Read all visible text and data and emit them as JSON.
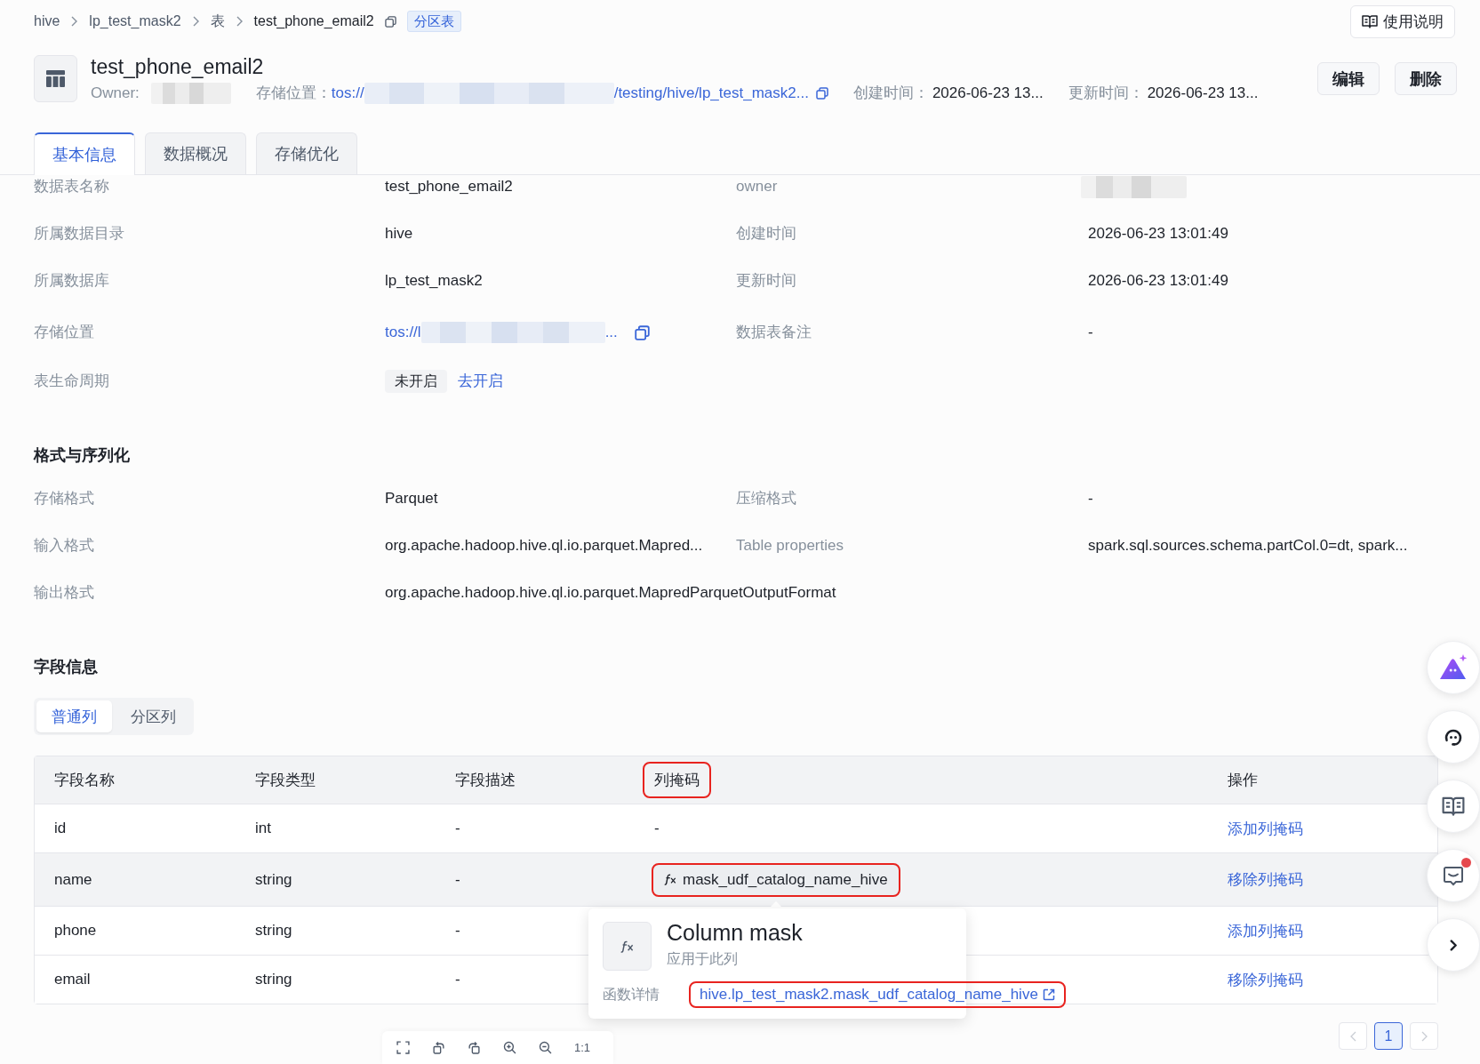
{
  "breadcrumb": {
    "items": [
      {
        "label": "hive",
        "current": false
      },
      {
        "label": "lp_test_mask2",
        "current": false
      },
      {
        "label": "表",
        "current": false
      },
      {
        "label": "test_phone_email2",
        "current": true
      }
    ],
    "tag": "分区表"
  },
  "help_button": "使用说明",
  "header": {
    "title": "test_phone_email2",
    "owner_label": "Owner:",
    "owner_redacted": true,
    "storage_label": "存储位置：",
    "storage_prefix": "tos://",
    "storage_redacted": true,
    "storage_suffix": "/testing/hive/lp_test_mask2...",
    "created_label": "创建时间：",
    "created_value": "2026-06-23 13...",
    "updated_label": "更新时间：",
    "updated_value": "2026-06-23 13..."
  },
  "actions": [
    "编辑",
    "删除"
  ],
  "tabs": [
    {
      "label": "基本信息",
      "selected": true
    },
    {
      "label": "数据概况",
      "selected": false
    },
    {
      "label": "存储优化",
      "selected": false
    }
  ],
  "basic_info": {
    "rows": [
      [
        {
          "kind": "text",
          "label": "数据表名称",
          "value": "test_phone_email2"
        },
        {
          "kind": "redacted",
          "label": "owner"
        }
      ],
      [
        {
          "kind": "text",
          "label": "所属数据目录",
          "value": "hive"
        },
        {
          "kind": "text",
          "label": "创建时间",
          "value": "2026-06-23 13:01:49"
        }
      ],
      [
        {
          "kind": "text",
          "label": "所属数据库",
          "value": "lp_test_mask2"
        },
        {
          "kind": "text",
          "label": "更新时间",
          "value": "2026-06-23 13:01:49"
        }
      ],
      [
        {
          "kind": "path",
          "label": "存储位置",
          "prefix": "tos://l",
          "redacted": true,
          "suffix": "..."
        },
        {
          "kind": "text",
          "label": "数据表备注",
          "value": "-"
        }
      ],
      [
        {
          "kind": "status",
          "label": "表生命周期",
          "tag": "未开启",
          "action": "去开启"
        }
      ]
    ]
  },
  "format": {
    "title": "格式与序列化",
    "rows": [
      [
        {
          "kind": "text",
          "label": "存储格式",
          "value": "Parquet"
        },
        {
          "kind": "text",
          "label": "压缩格式",
          "value": "-"
        }
      ],
      [
        {
          "kind": "text",
          "label": "输入格式",
          "value": "org.apache.hadoop.hive.ql.io.parquet.Mapred..."
        },
        {
          "kind": "text",
          "label": "Table properties",
          "value": "spark.sql.sources.schema.partCol.0=dt, spark..."
        }
      ],
      [
        {
          "kind": "text",
          "label": "输出格式",
          "value": "org.apache.hadoop.hive.ql.io.parquet.MapredParquetOutputFormat"
        }
      ]
    ]
  },
  "fields": {
    "title": "字段信息",
    "segments": [
      {
        "label": "普通列",
        "selected": true
      },
      {
        "label": "分区列",
        "selected": false
      }
    ],
    "columns": [
      {
        "label": "字段名称",
        "highlighted": false
      },
      {
        "label": "字段类型",
        "highlighted": false
      },
      {
        "label": "字段描述",
        "highlighted": false
      },
      {
        "label": "列掩码",
        "highlighted": true
      },
      {
        "label": "操作",
        "highlighted": false
      }
    ],
    "rows": [
      {
        "name": "id",
        "type": "int",
        "description": "-",
        "mask": {
          "kind": "none",
          "text": "-"
        },
        "action": "添加列掩码",
        "hovered": false
      },
      {
        "name": "name",
        "type": "string",
        "description": "-",
        "mask": {
          "kind": "function",
          "text": "mask_udf_catalog_name_hive",
          "highlighted": true
        },
        "action": "移除列掩码",
        "hovered": true
      },
      {
        "name": "phone",
        "type": "string",
        "description": "-",
        "action": "添加列掩码",
        "hovered": false
      },
      {
        "name": "email",
        "type": "string",
        "description": "-",
        "action": "移除列掩码",
        "hovered": false
      }
    ],
    "popover": {
      "title": "Column mask",
      "subtitle": "应用于此列",
      "detail_label": "函数详情",
      "link": "hive.lp_test_mask2.mask_udf_catalog_name_hive",
      "link_highlighted": true
    },
    "pagination": {
      "prev_disabled": true,
      "pages": [
        {
          "label": "1",
          "selected": true
        }
      ],
      "next_disabled": true
    }
  },
  "image_toolbar": {
    "actual_size": "1:1"
  },
  "float_buttons": [
    {
      "kind": "assistant",
      "badge": false
    },
    {
      "kind": "support",
      "badge": false
    },
    {
      "kind": "docs",
      "badge": false
    },
    {
      "kind": "feedback",
      "badge": true
    },
    {
      "kind": "collapse",
      "badge": false
    }
  ]
}
